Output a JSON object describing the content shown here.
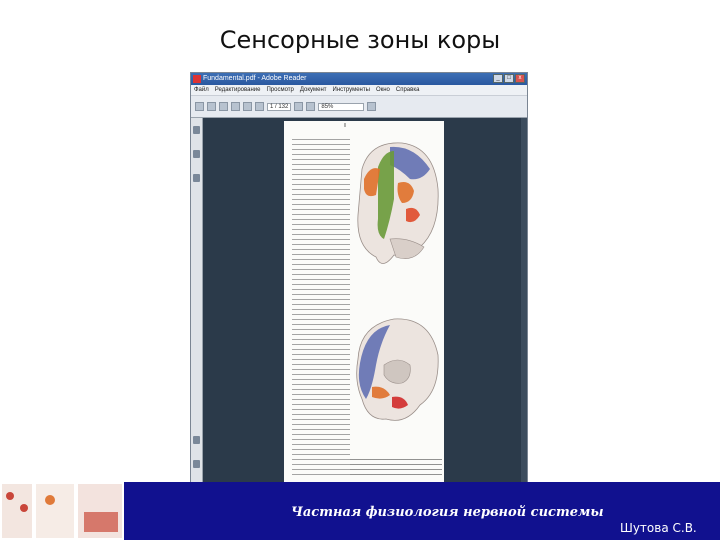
{
  "slide": {
    "title": "Сенсорные зоны коры",
    "footer_text": "Частная физиология нервной системы",
    "author": "Шутова С.В."
  },
  "window": {
    "title": "Fundamental.pdf - Adobe Reader",
    "menu": [
      "Файл",
      "Редактирование",
      "Просмотр",
      "Документ",
      "Инструменты",
      "Окно",
      "Справка"
    ],
    "toolbar": {
      "page_field": "1 / 132",
      "zoom_field": "85%"
    },
    "page_number": "ll"
  },
  "colors": {
    "bottom_band": "#11118f",
    "window_bg": "#2b3a4a",
    "brain_blue": "#5a6ab0",
    "brain_orange": "#e0702a",
    "brain_green": "#6a9a3a"
  }
}
